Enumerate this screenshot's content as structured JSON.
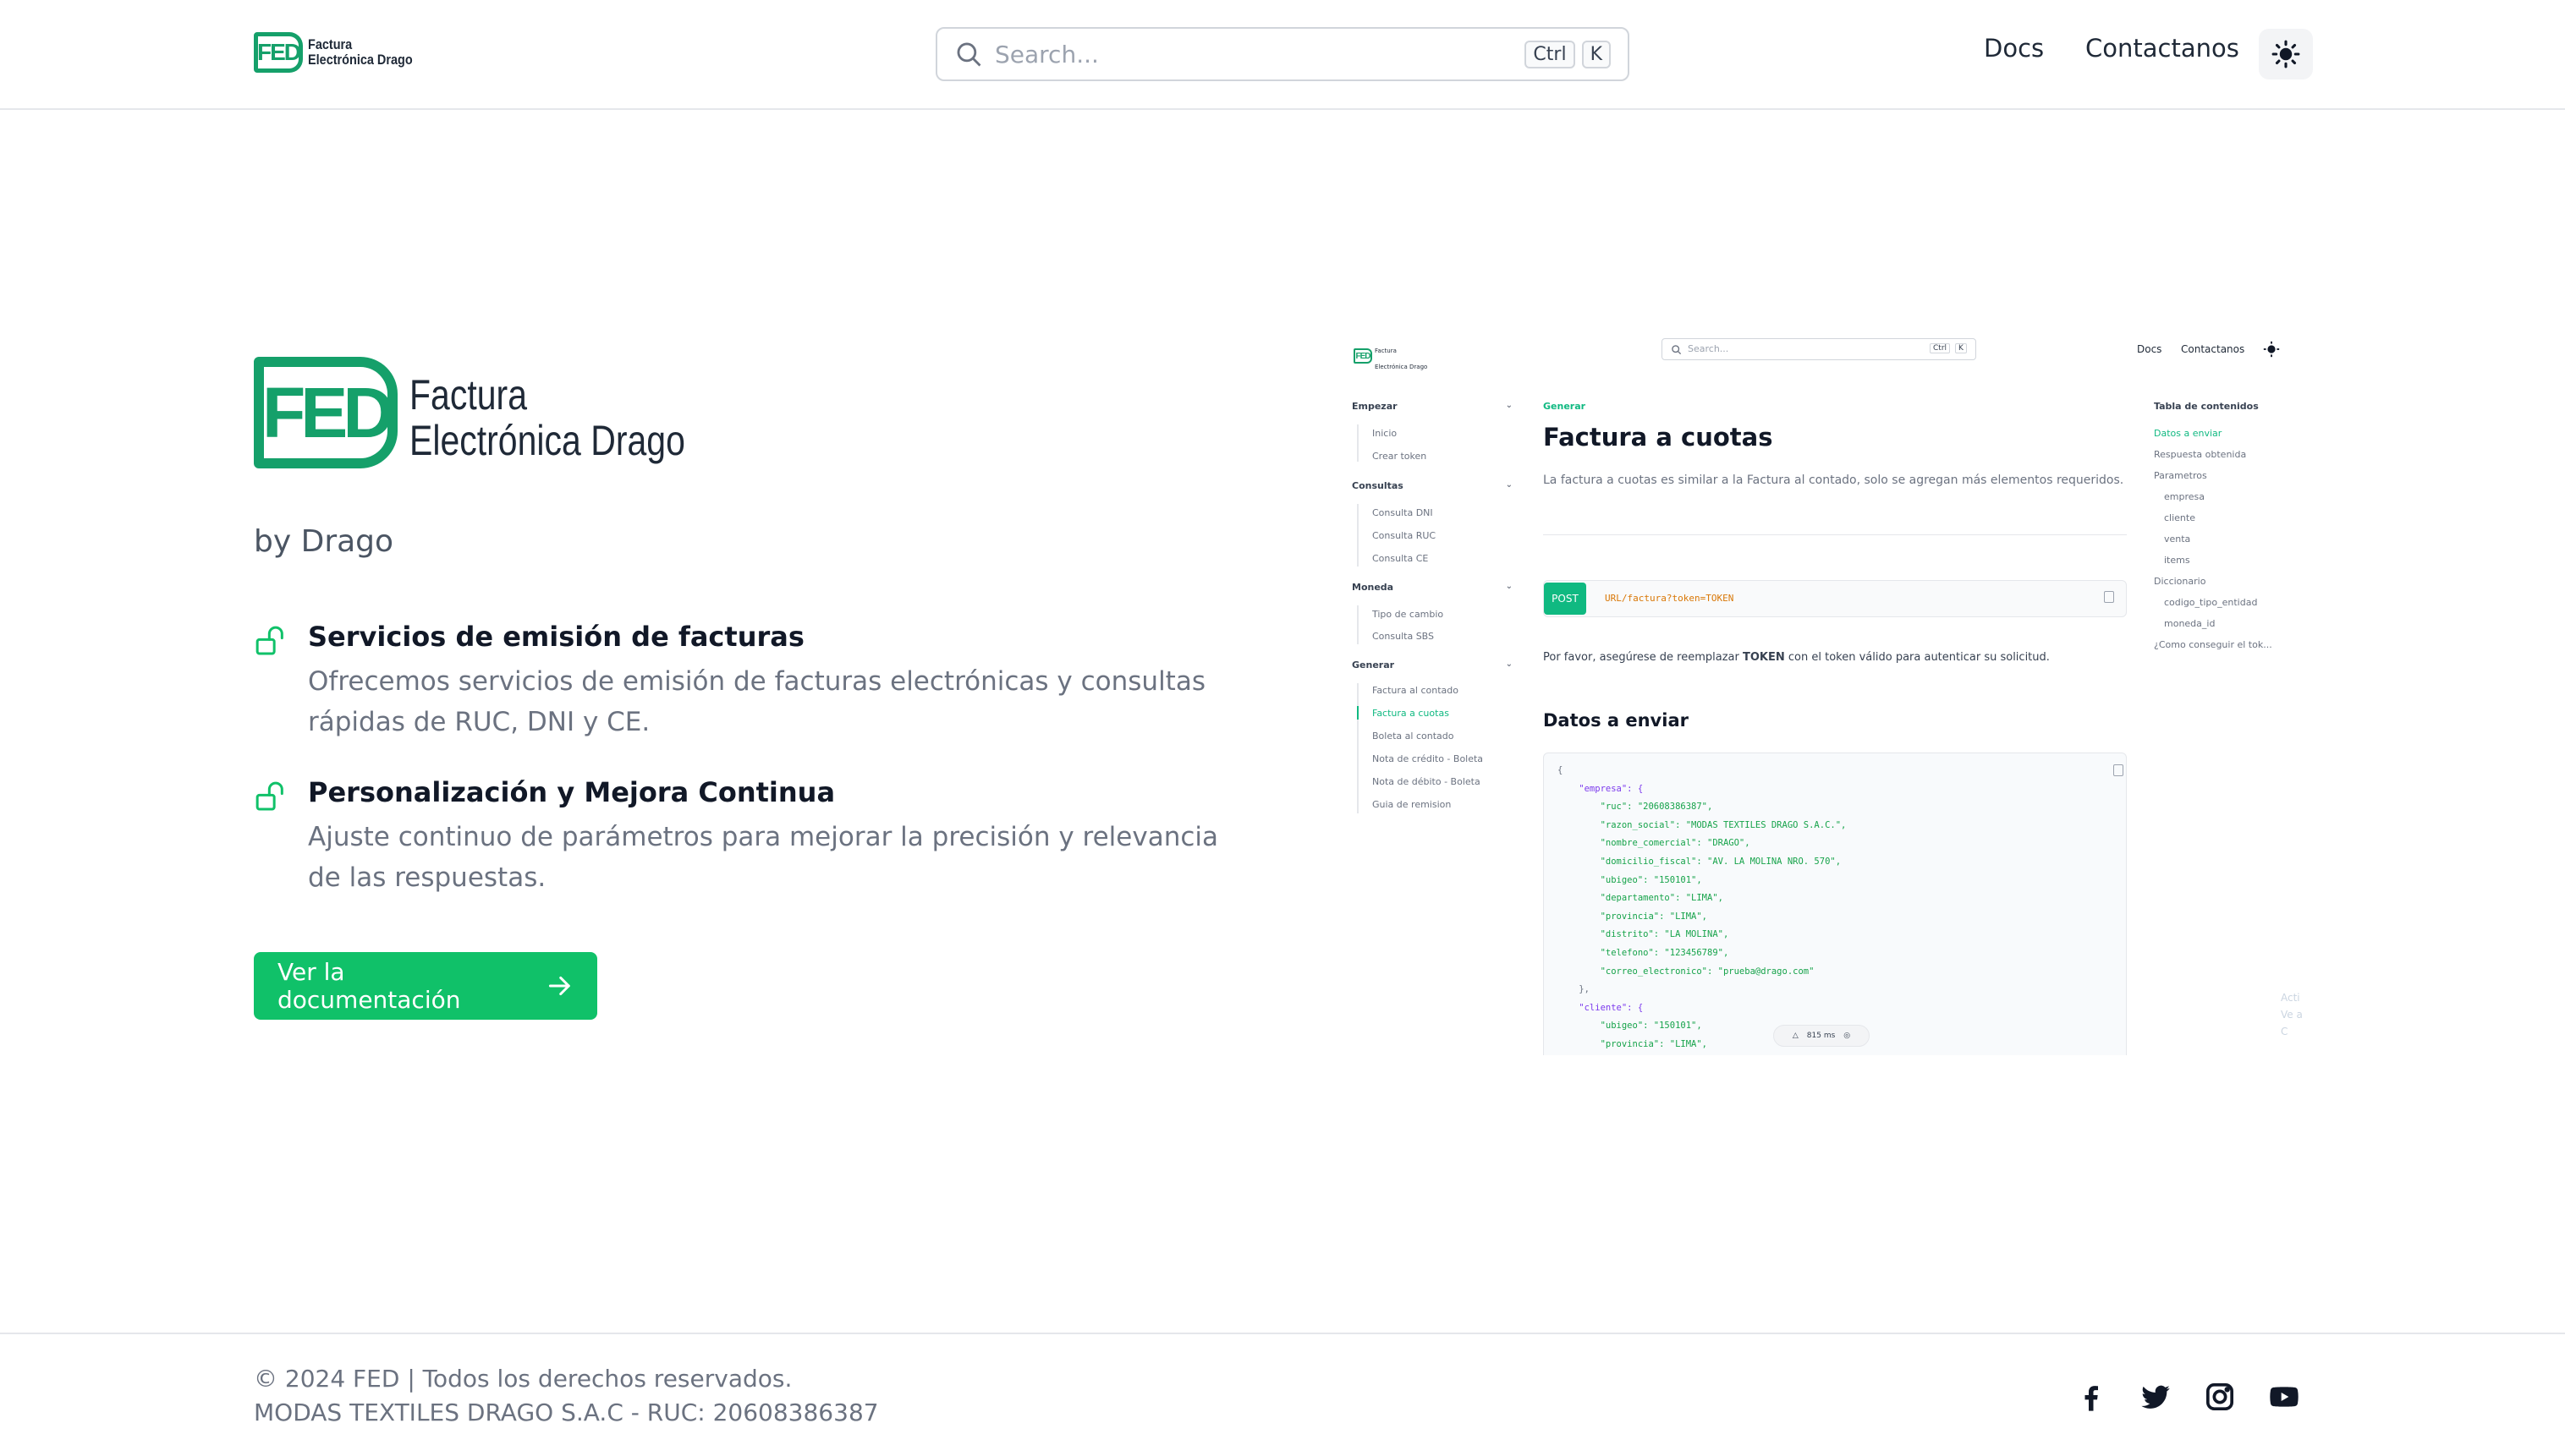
{
  "header": {
    "logo_text_line1": "Factura",
    "logo_text_line2": "Electrónica Drago",
    "logo_mark": "FED",
    "search_placeholder": "Search...",
    "search_shortcut_key1": "Ctrl",
    "search_shortcut_key2": "K",
    "nav_docs": "Docs",
    "nav_contact": "Contactanos",
    "theme_icon": "sun-icon"
  },
  "hero": {
    "logo_mark": "FED",
    "logo_line1": "Factura",
    "logo_line2": "Electrónica Drago",
    "byline": "by Drago",
    "features": [
      {
        "icon": "unlock-icon",
        "title": "Servicios de emisión de facturas",
        "description": "Ofrecemos servicios de emisión de facturas electrónicas y consultas rápidas de RUC, DNI y CE."
      },
      {
        "icon": "unlock-icon",
        "title": "Personalización y Mejora Continua",
        "description": "Ajuste continuo de parámetros para mejorar la precisión y relevancia de las respuestas."
      }
    ],
    "cta_label": "Ver la documentación",
    "cta_icon": "arrow-right-icon"
  },
  "preview": {
    "logo_mark": "FED",
    "logo_line1": "Factura",
    "logo_line2": "Electrónica Drago",
    "search_placeholder": "Search...",
    "key1": "Ctrl",
    "key2": "K",
    "nav_docs": "Docs",
    "nav_contact": "Contactanos",
    "sidebar": {
      "empezar": "Empezar",
      "inicio": "Inicio",
      "crear_token": "Crear token",
      "consultas": "Consultas",
      "consulta_dni": "Consulta DNI",
      "consulta_ruc": "Consulta RUC",
      "consulta_ce": "Consulta CE",
      "moneda": "Moneda",
      "tipo_cambio": "Tipo de cambio",
      "consulta_sbs": "Consulta SBS",
      "generar": "Generar",
      "factura_contado": "Factura al contado",
      "factura_cuotas": "Factura a cuotas",
      "boleta_contado": "Boleta al contado",
      "nota_credito": "Nota de crédito - Boleta",
      "nota_debito": "Nota de débito - Boleta",
      "guia_remision": "Guia de remision"
    },
    "breadcrumb": "Generar",
    "title": "Factura a cuotas",
    "description": "La factura a cuotas es similar a la Factura al contado, solo se agregan más elementos requeridos.",
    "method": "POST",
    "url": "URL/factura?token=TOKEN",
    "note_before": "Por favor, asegúrese de reemplazar ",
    "note_bold": "TOKEN",
    "note_after": " con el token válido para autenticar su solicitud.",
    "section_title": "Datos a enviar",
    "code_lines": [
      "{",
      "    \"empresa\": {",
      "        \"ruc\": \"20608386387\",",
      "        \"razon_social\": \"MODAS TEXTILES DRAGO S.A.C.\",",
      "        \"nombre_comercial\": \"DRAGO\",",
      "        \"domicilio_fiscal\": \"AV. LA MOLINA NRO. 570\",",
      "        \"ubigeo\": \"150101\",",
      "        \"departamento\": \"LIMA\",",
      "        \"provincia\": \"LIMA\",",
      "        \"distrito\": \"LA MOLINA\",",
      "        \"telefono\": \"123456789\",",
      "        \"correo_electronico\": \"prueba@drago.com\"",
      "    },",
      "    \"cliente\": {",
      "        \"ubigeo\": \"150101\",",
      "        \"provincia\": \"LIMA\","
    ],
    "pill_text": "815 ms",
    "toc": {
      "title": "Tabla de contenidos",
      "datos": "Datos a enviar",
      "respuesta": "Respuesta obtenida",
      "parametros": "Parametros",
      "empresa": "empresa",
      "cliente": "cliente",
      "venta": "venta",
      "items": "items",
      "diccionario": "Diccionario",
      "codigo_tipo_entidad": "codigo_tipo_entidad",
      "moneda_id": "moneda_id",
      "como_conseguir": "¿Como conseguir el tok..."
    },
    "ghost_line1": "Acti",
    "ghost_line2": "Ve a C"
  },
  "footer": {
    "copyright": "© 2024 FED | Todos los derechos reservados.",
    "company": "MODAS TEXTILES DRAGO S.A.C - RUC: 20608386387",
    "social": [
      "facebook-icon",
      "twitter-icon",
      "instagram-icon",
      "youtube-icon"
    ]
  },
  "colors": {
    "brand_green": "#10c169",
    "logo_green": "#15a06a",
    "text_dark": "#111827",
    "text_muted": "#6b7280"
  }
}
